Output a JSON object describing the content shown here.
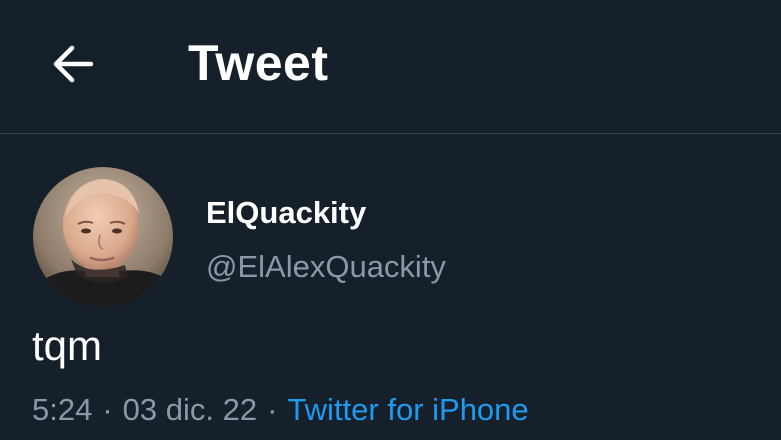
{
  "header": {
    "back_icon": "arrow-left-icon",
    "title": "Tweet"
  },
  "tweet": {
    "author": {
      "display_name": "ElQuackity",
      "handle": "@ElAlexQuackity",
      "avatar": "profile-photo"
    },
    "text": "tqm",
    "time": "5:24",
    "separator": "·",
    "date": "03 dic. 22",
    "source": "Twitter for iPhone"
  },
  "colors": {
    "background": "#15202b",
    "divider": "#38444d",
    "primary_text": "#ffffff",
    "secondary_text": "#8b98a5",
    "link": "#1d9bf0"
  }
}
